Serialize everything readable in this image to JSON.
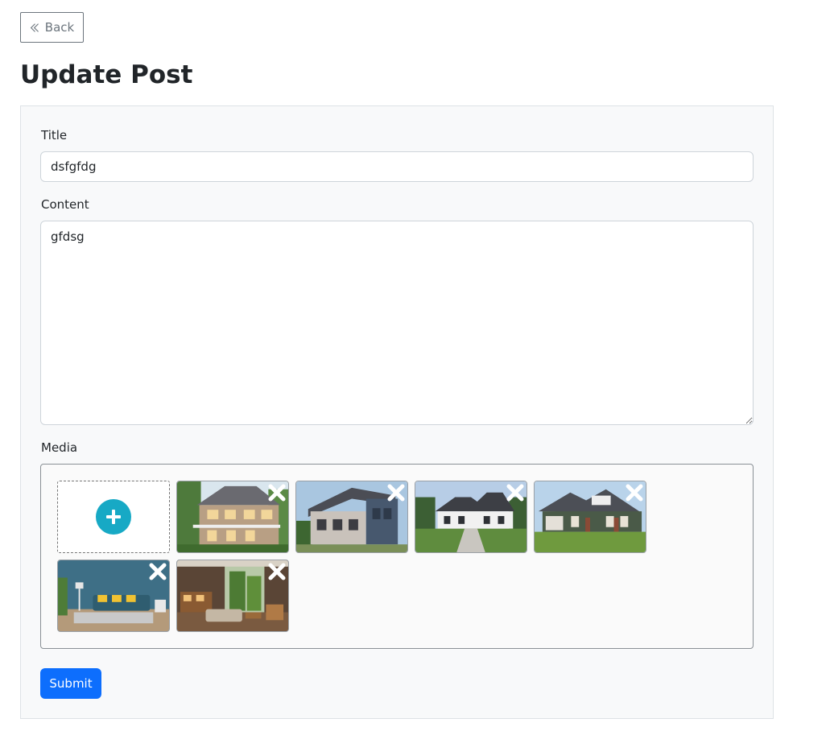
{
  "header": {
    "back_label": "Back",
    "page_title": "Update Post"
  },
  "form": {
    "title_label": "Title",
    "title_value": "dsfgfdg",
    "content_label": "Content",
    "content_value": "gfdsg",
    "media_label": "Media",
    "submit_label": "Submit"
  },
  "media": {
    "add_icon": "plus-circle-icon",
    "remove_icon": "close-icon",
    "items": [
      {
        "name": "media-house-1"
      },
      {
        "name": "media-house-2"
      },
      {
        "name": "media-house-3"
      },
      {
        "name": "media-house-4"
      },
      {
        "name": "media-living-room"
      },
      {
        "name": "media-interior"
      }
    ]
  },
  "colors": {
    "accent": "#0d6efd",
    "add_circle": "#17a9c5"
  }
}
